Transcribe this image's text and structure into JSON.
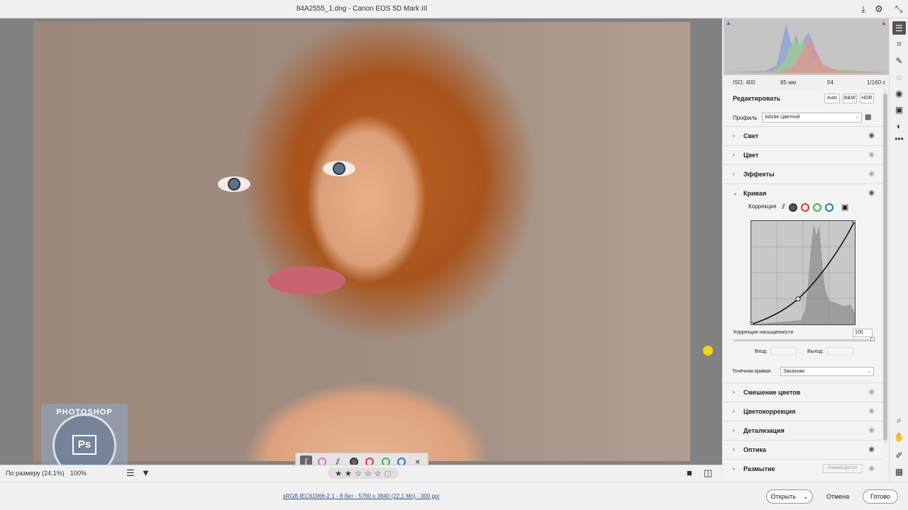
{
  "window": {
    "title": "84A2555_1.dng  -  Canon EOS 5D Mark III"
  },
  "top_icons": [
    "save-icon",
    "gear-icon",
    "minimize-view-icon"
  ],
  "canvas": {
    "zoom_label": "По размеру (24,1%)",
    "zoom_100": "100%"
  },
  "float_toolbar": {
    "close_glyph": "×"
  },
  "rating": {
    "stars": 5,
    "filled": 2
  },
  "status": {
    "info": "sRGB IEC61966-2.1 - 8 бит - 5760 x 3840 (22,1 Мп) - 300 ppi",
    "open": "Открыть",
    "cancel": "Отмена",
    "done": "Готово"
  },
  "camera": {
    "iso": "ISO: 400",
    "focal": "85 мм",
    "aperture": "f/4",
    "shutter": "1/160 с"
  },
  "edit": {
    "title": "Редактировать",
    "auto": "Auto",
    "bw": "B&W",
    "hdr": "HDR",
    "profile_label": "Профиль",
    "profile_value": "Adobe Цветной"
  },
  "sections": {
    "light": "Свет",
    "color": "Цвет",
    "effects": "Эффекты",
    "curve": "Кривая",
    "color_mixer": "Смешение цветов",
    "color_grading": "Цветокоррекция",
    "detail": "Детализация",
    "optics": "Оптика",
    "blur": "Размытие",
    "early_access": "Ранний доступ"
  },
  "curve": {
    "correction_label": "Коррекция",
    "saturation_label": "Коррекция насыщенности",
    "saturation_value": "100",
    "input_label": "Вход:",
    "output_label": "Выход:",
    "point_curve_label": "Точечная кривая",
    "point_curve_value": "Заказная",
    "saturation": 1.0
  },
  "colors": {
    "accent": "#1473e6",
    "red": "#e03030",
    "green": "#38b44a",
    "blue": "#2e6fd6"
  }
}
